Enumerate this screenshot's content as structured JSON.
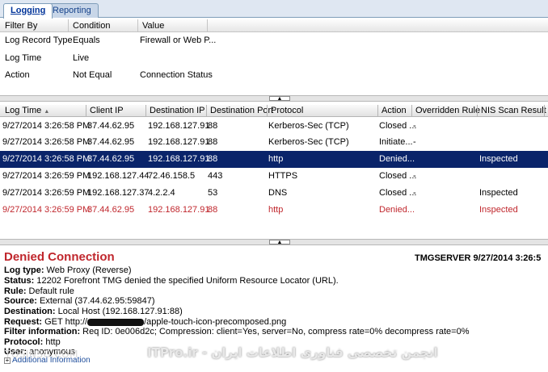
{
  "tabs": [
    {
      "label": "Logging",
      "active": true
    },
    {
      "label": "Reporting",
      "active": false
    }
  ],
  "filter": {
    "headers": [
      "Filter By",
      "Condition",
      "Value"
    ],
    "rows": [
      {
        "filter_by": "Log Record Type",
        "condition": "Equals",
        "value": "Firewall or Web P..."
      },
      {
        "filter_by": "Log Time",
        "condition": "Live",
        "value": ""
      },
      {
        "filter_by": "Action",
        "condition": "Not Equal",
        "value": "Connection Status"
      }
    ]
  },
  "log_grid": {
    "headers": [
      "Log Time",
      "Client IP",
      "Destination IP",
      "Destination Port",
      "Protocol",
      "Action",
      "Overridden Rule",
      "NIS Scan Result"
    ],
    "sort_indicator": "▲",
    "rows": [
      {
        "time": "9/27/2014 3:26:58 PM",
        "client_ip": "37.44.62.95",
        "dest_ip": "192.168.127.91",
        "port": "88",
        "protocol": "Kerberos-Sec (TCP)",
        "action": "Closed ...",
        "rule": "-",
        "nis": ""
      },
      {
        "time": "9/27/2014 3:26:58 PM",
        "client_ip": "37.44.62.95",
        "dest_ip": "192.168.127.91",
        "port": "88",
        "protocol": "Kerberos-Sec (TCP)",
        "action": "Initiate...",
        "rule": "-",
        "nis": ""
      },
      {
        "time": "9/27/2014 3:26:58 PM",
        "client_ip": "37.44.62.95",
        "dest_ip": "192.168.127.91",
        "port": "88",
        "protocol": "http",
        "action": "Denied...",
        "rule": "",
        "nis": "Inspected"
      },
      {
        "time": "9/27/2014 3:26:59 PM",
        "client_ip": "192.168.127.44",
        "dest_ip": "72.46.158.5",
        "port": "443",
        "protocol": "HTTPS",
        "action": "Closed ...",
        "rule": "-",
        "nis": ""
      },
      {
        "time": "9/27/2014 3:26:59 PM",
        "client_ip": "192.168.127.37",
        "dest_ip": "4.2.2.4",
        "port": "53",
        "protocol": "DNS",
        "action": "Closed ...",
        "rule": "-",
        "nis": "Inspected"
      },
      {
        "time": "9/27/2014 3:26:59 PM",
        "client_ip": "37.44.62.95",
        "dest_ip": "192.168.127.91",
        "port": "88",
        "protocol": "http",
        "action": "Denied...",
        "rule": "",
        "nis": "Inspected"
      }
    ]
  },
  "details": {
    "title": "Denied Connection",
    "server": "TMGSERVER 9/27/2014 3:26:5",
    "log_type_label": "Log type:",
    "log_type": " Web Proxy (Reverse)",
    "status_label": "Status:",
    "status": " 12202 Forefront TMG denied the specified Uniform Resource Locator (URL).",
    "rule_label": "Rule:",
    "rule": " Default rule",
    "source_label": "Source:",
    "source": " External (37.44.62.95:59847)",
    "destination_label": "Destination:",
    "destination": " Local Host (192.168.127.91:88)",
    "request_label": "Request:",
    "request_prefix": " GET http://",
    "request_suffix": "/apple-touch-icon-precomposed.png",
    "filter_label": "Filter information:",
    "filter": " Req ID: 0e006d2c; Compression: client=Yes, server=No, compress rate=0% decompress rate=0%",
    "protocol_label": "Protocol:",
    "protocol": " http",
    "user_label": "User:",
    "user": " anonymous",
    "additional": "Additional Information"
  },
  "watermarks": {
    "left": "TOSINSO.COM",
    "center": "ITPro.ir - انجمن تخصصی فناوری اطلاعات ایران"
  },
  "colors": {
    "selected_row": "#0a246a",
    "error_red": "#c0272d"
  }
}
